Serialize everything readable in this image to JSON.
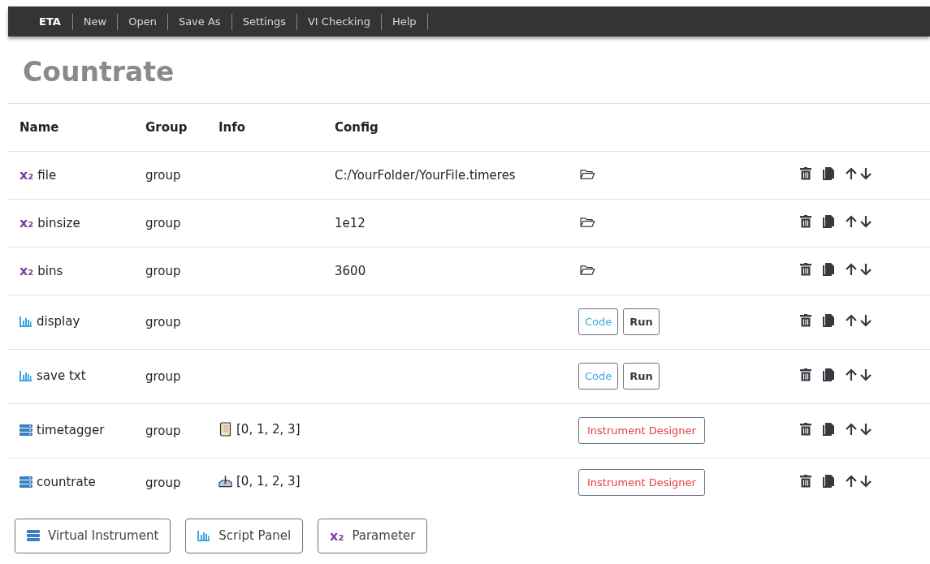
{
  "navbar": {
    "brand": "ETA",
    "items": [
      "New",
      "Open",
      "Save As",
      "Settings",
      "VI Checking",
      "Help"
    ]
  },
  "title": "Countrate",
  "table": {
    "columns": [
      "Name",
      "Group",
      "Info",
      "Config"
    ],
    "rows": [
      {
        "kind": "parameter",
        "glyph": "x₂",
        "name": "file",
        "group": "group",
        "config": "C:/YourFolder/YourFile.timeres"
      },
      {
        "kind": "parameter",
        "glyph": "x₂",
        "name": "binsize",
        "group": "group",
        "config": "1e12"
      },
      {
        "kind": "parameter",
        "glyph": "x₂",
        "name": "bins",
        "group": "group",
        "config": "3600"
      },
      {
        "kind": "script",
        "name": "display",
        "group": "group",
        "buttons": [
          "Code",
          "Run"
        ]
      },
      {
        "kind": "script",
        "name": "save txt",
        "group": "group",
        "buttons": [
          "Code",
          "Run"
        ]
      },
      {
        "kind": "instrument",
        "name": "timetagger",
        "group": "group",
        "info": {
          "kind": "scroll",
          "text": "[0, 1, 2, 3]"
        },
        "buttons": [
          "Instrument Designer"
        ]
      },
      {
        "kind": "instrument",
        "name": "countrate",
        "group": "group",
        "info": {
          "kind": "tray",
          "text": "[0, 1, 2, 3]"
        },
        "buttons": [
          "Instrument Designer"
        ]
      }
    ]
  },
  "add_buttons": [
    {
      "kind": "instrument",
      "label": "Virtual Instrument"
    },
    {
      "kind": "script",
      "label": "Script Panel"
    },
    {
      "kind": "parameter",
      "glyph": "x₂",
      "label": "Parameter"
    }
  ]
}
